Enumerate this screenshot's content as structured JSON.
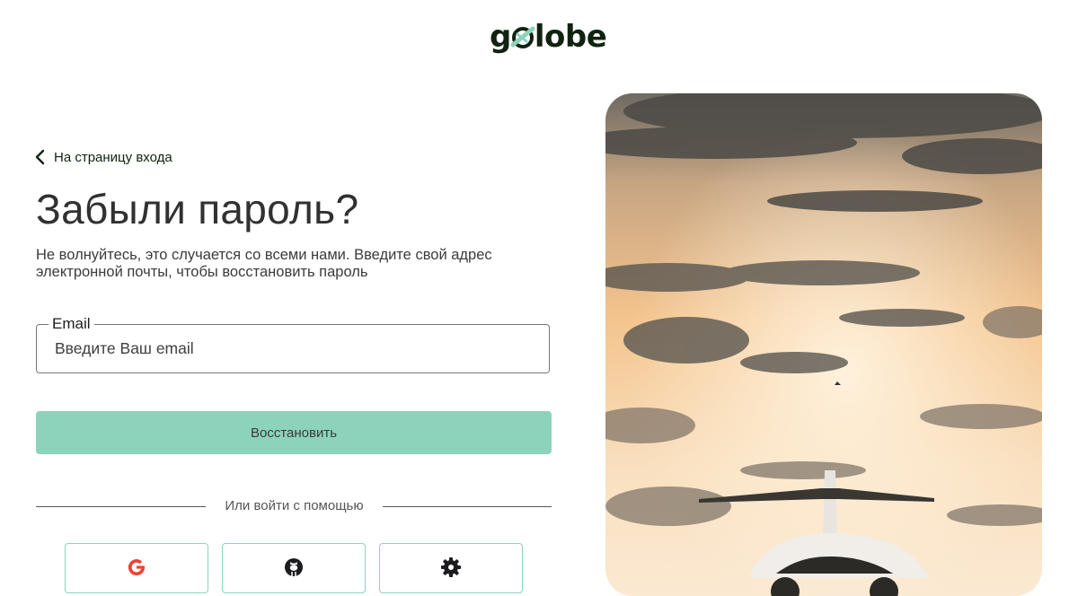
{
  "logo": {
    "text_left": "g",
    "text_right": "lobe"
  },
  "back_link": {
    "label": "На страницу входа"
  },
  "page": {
    "title": "Забыли пароль?",
    "subtitle": "Не волнуйтесь, это случается со всеми нами. Введите свой адрес электронной почты, чтобы восстановить пароль"
  },
  "email": {
    "label": "Email",
    "placeholder": "Введите Ваш email",
    "value": ""
  },
  "submit": {
    "label": "Восстановить"
  },
  "divider": {
    "text": "Или войти с помощью"
  },
  "social": [
    {
      "provider": "google",
      "icon": "google-icon",
      "color": "#ea4335"
    },
    {
      "provider": "github",
      "icon": "github-icon",
      "color": "#1c1b1f"
    },
    {
      "provider": "settings",
      "icon": "gear-icon",
      "color": "#1c1b1f"
    }
  ],
  "colors": {
    "accent": "#8dd3bb",
    "dark": "#112211",
    "text": "#313131"
  },
  "hero_image": {
    "icon": "airplane-sunset-image"
  }
}
